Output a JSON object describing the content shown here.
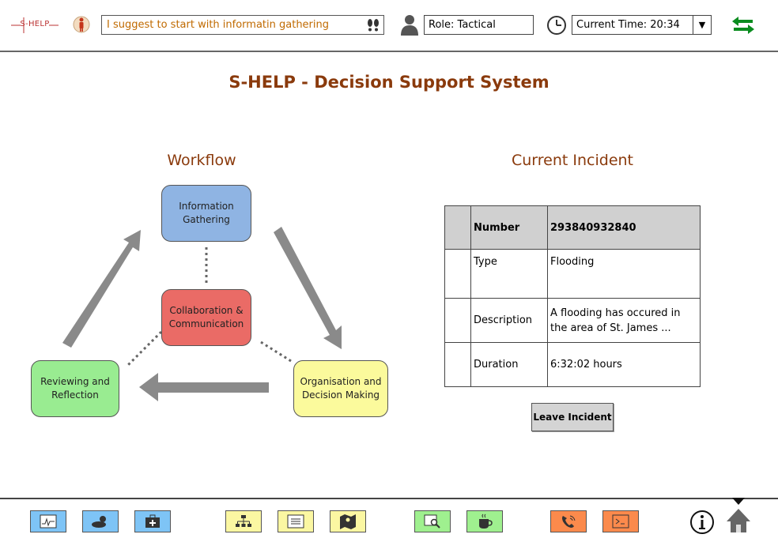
{
  "topbar": {
    "logo_text": "S-HELP",
    "suggestion": "I suggest to start with informatin gathering",
    "role": "Role: Tactical",
    "current_time": "Current Time: 20:34"
  },
  "title": "S-HELP - Decision Support System",
  "workflow": {
    "heading": "Workflow",
    "nodes": {
      "info": "Information Gathering",
      "collab": "Collaboration & Communication",
      "review": "Reviewing and Reflection",
      "org": "Organisation and Decision Making"
    },
    "colors": {
      "info": "#8fb4e3",
      "collab": "#ea6b66",
      "review": "#99ec91",
      "org": "#fbfa9c"
    }
  },
  "incident": {
    "heading": "Current Incident",
    "rows": [
      {
        "label": "Number",
        "value": "293840932840"
      },
      {
        "label": "Type",
        "value": "Flooding"
      },
      {
        "label": "Description",
        "value": "A flooding has occured in the area of St. James ..."
      },
      {
        "label": "Duration",
        "value": "6:32:02 hours"
      }
    ],
    "leave_button": "Leave Incident"
  },
  "icons": {
    "top": [
      "helper-person-icon",
      "footprints-icon",
      "user-icon",
      "clock-icon",
      "swap-arrows-icon"
    ],
    "bottom": [
      "monitor-chart-icon",
      "weather-icon",
      "medical-kit-icon",
      "org-chart-icon",
      "list-window-icon",
      "map-icon",
      "search-window-icon",
      "coffee-icon",
      "phone-icon",
      "terminal-icon",
      "info-icon",
      "home-icon"
    ]
  }
}
